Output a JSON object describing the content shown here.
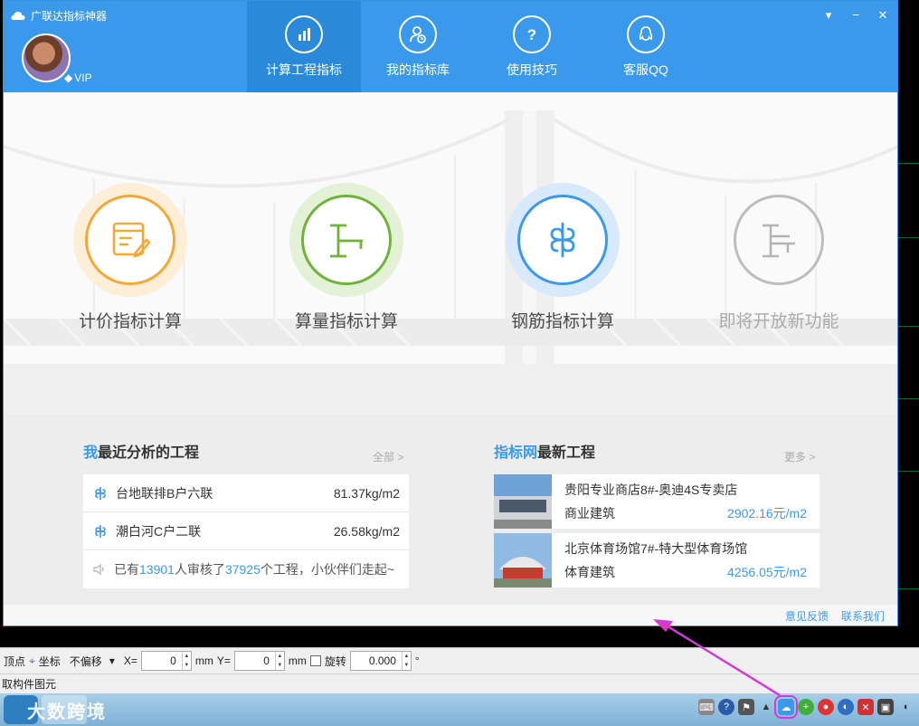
{
  "window": {
    "title": "广联达指标神器",
    "controls": [
      "▾",
      "−",
      "✕"
    ],
    "user_badge": "VIP"
  },
  "nav": [
    {
      "label": "计算工程指标",
      "icon": "bar-chart-icon",
      "active": true
    },
    {
      "label": "我的指标库",
      "icon": "user-library-icon",
      "active": false
    },
    {
      "label": "使用技巧",
      "icon": "question-icon",
      "active": false
    },
    {
      "label": "客服QQ",
      "icon": "qq-penguin-icon",
      "active": false
    }
  ],
  "features": [
    {
      "label": "计价指标计算",
      "color": "#f3a838",
      "halo": "#fdeed8",
      "icon": "pricing-form-icon"
    },
    {
      "label": "算量指标计算",
      "color": "#6fb339",
      "halo": "#e3f1d6",
      "icon": "quantity-beam-icon"
    },
    {
      "label": "钢筋指标计算",
      "color": "#3a99ea",
      "halo": "#d7e9fb",
      "icon": "rebar-icon"
    },
    {
      "label": "即将开放新功能",
      "color": "#b3b3b3",
      "halo": "transparent",
      "icon": "coming-soon-icon"
    }
  ],
  "recent": {
    "title_highlight": "我",
    "title_rest": "最近分析的工程",
    "more": "全部 >",
    "items": [
      {
        "name": "台地联排B户六联",
        "value": "81.37kg/m2"
      },
      {
        "name": "潮白河C户二联",
        "value": "26.58kg/m2"
      }
    ],
    "stat": {
      "prefix": "已有",
      "users": "13901",
      "middle": "人审核了",
      "projects": "37925",
      "suffix": "个工程，小伙伴们走起~"
    }
  },
  "latest": {
    "title_highlight": "指标网",
    "title_rest": "最新工程",
    "more": "更多 >",
    "items": [
      {
        "title": "贵阳专业商店8#-奥迪4S专卖店",
        "type": "商业建筑",
        "price": "2902.16元/m2"
      },
      {
        "title": "北京体育场馆7#-特大型体育场馆",
        "type": "体育建筑",
        "price": "4256.05元/m2"
      }
    ]
  },
  "footer": {
    "feedback": "意见反馈",
    "contact": "联系我们"
  },
  "cad_toolbar": {
    "vertex": "顶点",
    "coord": "坐标",
    "offset_mode": "不偏移",
    "x_label": "X=",
    "x_value": "0",
    "y_label": "Y=",
    "y_value": "0",
    "unit": "mm",
    "rotate_label": "旋转",
    "rotate_value": "0.000",
    "degree": "°"
  },
  "status_text": "取构件图元",
  "taskbar": {
    "watermark": "大数跨境"
  },
  "colors": {
    "brand": "#3a99ea",
    "annotation": "#d23ad8"
  }
}
